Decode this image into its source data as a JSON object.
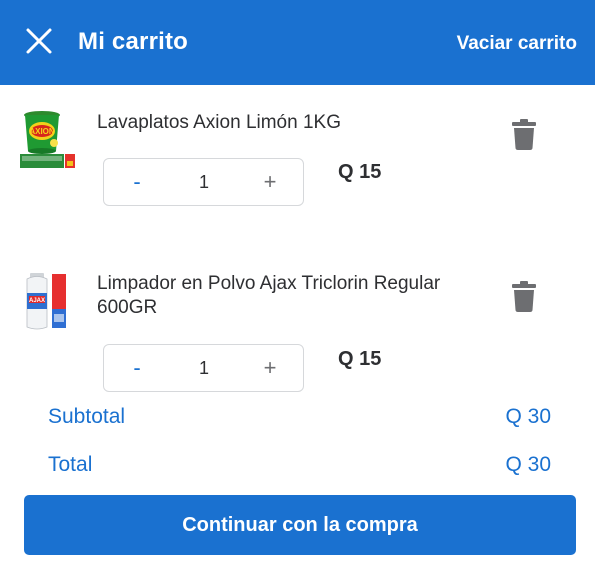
{
  "header": {
    "title": "Mi carrito",
    "clear_label": "Vaciar carrito",
    "close_icon": "close-icon",
    "background": "#1a71d0"
  },
  "items": [
    {
      "name": "Lavaplatos Axion Limón 1KG",
      "quantity": "1",
      "minus_label": "-",
      "plus_label": "+",
      "price": "Q 15",
      "image_icon": "axion-product-image",
      "delete_icon": "trash-icon"
    },
    {
      "name": "Limpador en Polvo Ajax Triclorin Regular 600GR",
      "quantity": "1",
      "minus_label": "-",
      "plus_label": "+",
      "price": "Q 15",
      "image_icon": "ajax-product-image",
      "delete_icon": "trash-icon"
    }
  ],
  "summary": {
    "subtotal_label": "Subtotal",
    "subtotal_value": "Q 30",
    "total_label": "Total",
    "total_value": "Q 30"
  },
  "actions": {
    "continue_label": "Continuar con la compra"
  },
  "colors": {
    "accent": "#1a71d0",
    "text": "#2e2f32",
    "icon_grey": "#6d6e71"
  }
}
